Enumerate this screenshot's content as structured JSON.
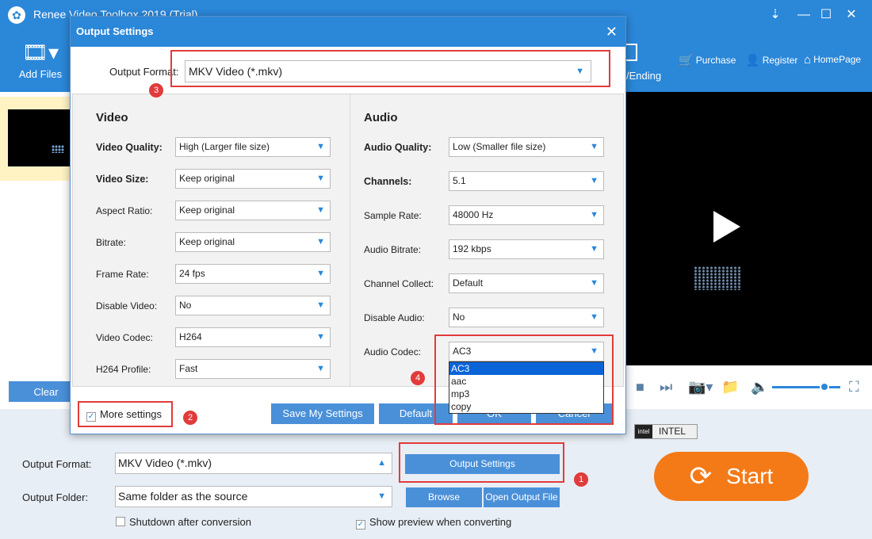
{
  "app": {
    "title": "Renee Video Toolbox 2019 (Trial)",
    "window_controls": {
      "pin": "⇣",
      "minimize": "—",
      "maximize": "☐",
      "close": "✕"
    }
  },
  "toolbar": {
    "add_files_label": "Add Files",
    "partial_label": "/Ending",
    "purchase_label": "Purchase",
    "register_label": "Register",
    "homepage_label": "HomePage"
  },
  "left_panel": {
    "clear_label": "Clear"
  },
  "dialog": {
    "title": "Output Settings",
    "output_format_label": "Output Format:",
    "output_format_value": "MKV Video (*.mkv)",
    "video": {
      "heading": "Video",
      "fields": [
        {
          "label": "Video Quality:",
          "value": "High (Larger file size)"
        },
        {
          "label": "Video Size:",
          "value": "Keep original"
        },
        {
          "label": "Aspect Ratio:",
          "value": "Keep original"
        },
        {
          "label": "Bitrate:",
          "value": "Keep original"
        },
        {
          "label": "Frame Rate:",
          "value": "24 fps"
        },
        {
          "label": "Disable Video:",
          "value": "No"
        },
        {
          "label": "Video Codec:",
          "value": "H264"
        },
        {
          "label": "H264 Profile:",
          "value": "Fast"
        }
      ]
    },
    "audio": {
      "heading": "Audio",
      "fields": [
        {
          "label": "Audio Quality:",
          "value": "Low (Smaller file size)"
        },
        {
          "label": "Channels:",
          "value": "5.1"
        },
        {
          "label": "Sample Rate:",
          "value": "48000 Hz"
        },
        {
          "label": "Audio Bitrate:",
          "value": "192 kbps"
        },
        {
          "label": "Channel Collect:",
          "value": "Default"
        },
        {
          "label": "Disable Audio:",
          "value": "No"
        },
        {
          "label": "Audio Codec:",
          "value": "AC3"
        }
      ],
      "codec_options": [
        "AC3",
        "aac",
        "mp3",
        "copy"
      ],
      "codec_selected_index": 0
    },
    "more_settings_label": "More settings",
    "more_settings_checked": true,
    "buttons": {
      "save": "Save My Settings",
      "default": "Default",
      "ok": "OK",
      "cancel": "Cancel"
    }
  },
  "callouts": [
    "1",
    "2",
    "3",
    "4"
  ],
  "bottom": {
    "output_format_label": "Output Format:",
    "output_format_value": "MKV Video (*.mkv)",
    "output_settings_label": "Output Settings",
    "output_folder_label": "Output Folder:",
    "output_folder_value": "Same folder as the source",
    "browse_label": "Browse",
    "open_output_label": "Open Output File",
    "shutdown_label": "Shutdown after conversion",
    "shutdown_checked": false,
    "preview_label": "Show preview when converting",
    "preview_checked": true,
    "intel_label": "INTEL",
    "intel_chip": "intel",
    "start_label": "Start"
  },
  "colors": {
    "brand_blue": "#2b87d8",
    "button_blue": "#4a90d9",
    "start_orange": "#f47a18",
    "highlight_red": "#e23b3b",
    "selection_blue": "#0a64d8"
  },
  "icons": {
    "app": "film-reel-icon",
    "add_files": "film-add-icon",
    "purchase": "cart-icon",
    "register": "user-icon",
    "homepage": "home-icon",
    "play": "play-icon",
    "start": "refresh-icon"
  }
}
